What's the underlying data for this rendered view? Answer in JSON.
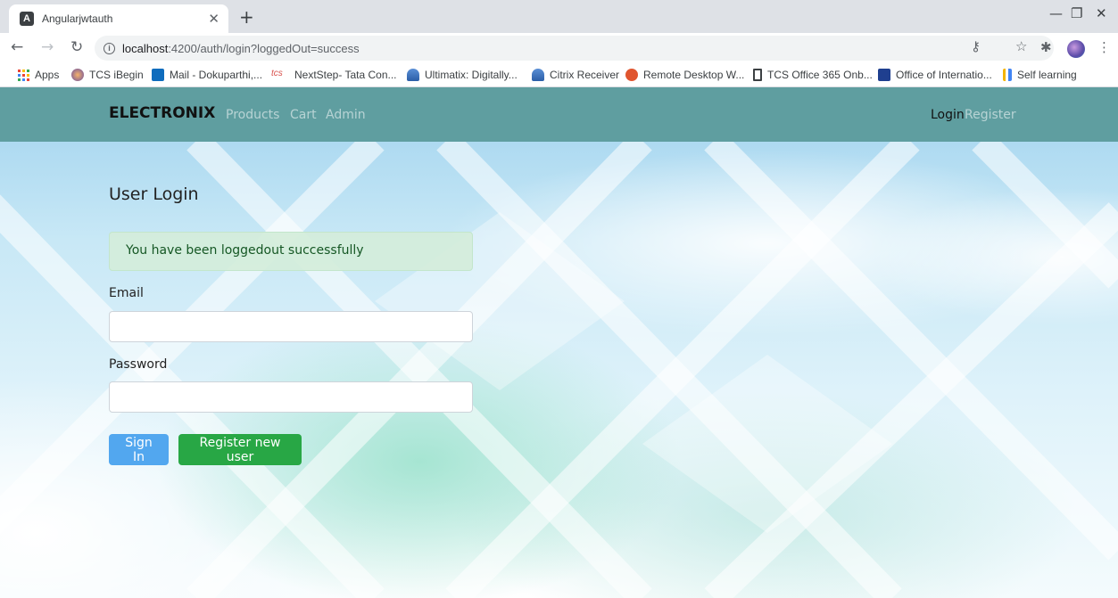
{
  "browser": {
    "tab_title": "Angularjwtauth",
    "url_host": "localhost",
    "url_rest": ":4200/auth/login?loggedOut=success",
    "bookmarks": {
      "apps": "Apps",
      "items": [
        "TCS iBegin",
        "Mail - Dokuparthi,...",
        "NextStep- Tata Con...",
        "Ultimatix: Digitally...",
        "Citrix Receiver",
        "Remote Desktop W...",
        "TCS Office 365 Onb...",
        "Office of Internatio...",
        "Self learning"
      ]
    }
  },
  "navbar": {
    "brand": "ELECTRONIX",
    "links": [
      "Products",
      "Cart",
      "Admin"
    ],
    "right_links": [
      "Login",
      "Register"
    ]
  },
  "login": {
    "title": "User Login",
    "alert": "You have been loggedout successfully",
    "email_label": "Email",
    "email_value": "",
    "password_label": "Password",
    "password_value": "",
    "sign_in": "Sign In",
    "register": "Register new user"
  },
  "colors": {
    "navbar": "#5f9ea0",
    "primary": "#52a7ef",
    "success": "#28a745",
    "alert_bg": "#d4edda",
    "alert_text": "#155724"
  }
}
